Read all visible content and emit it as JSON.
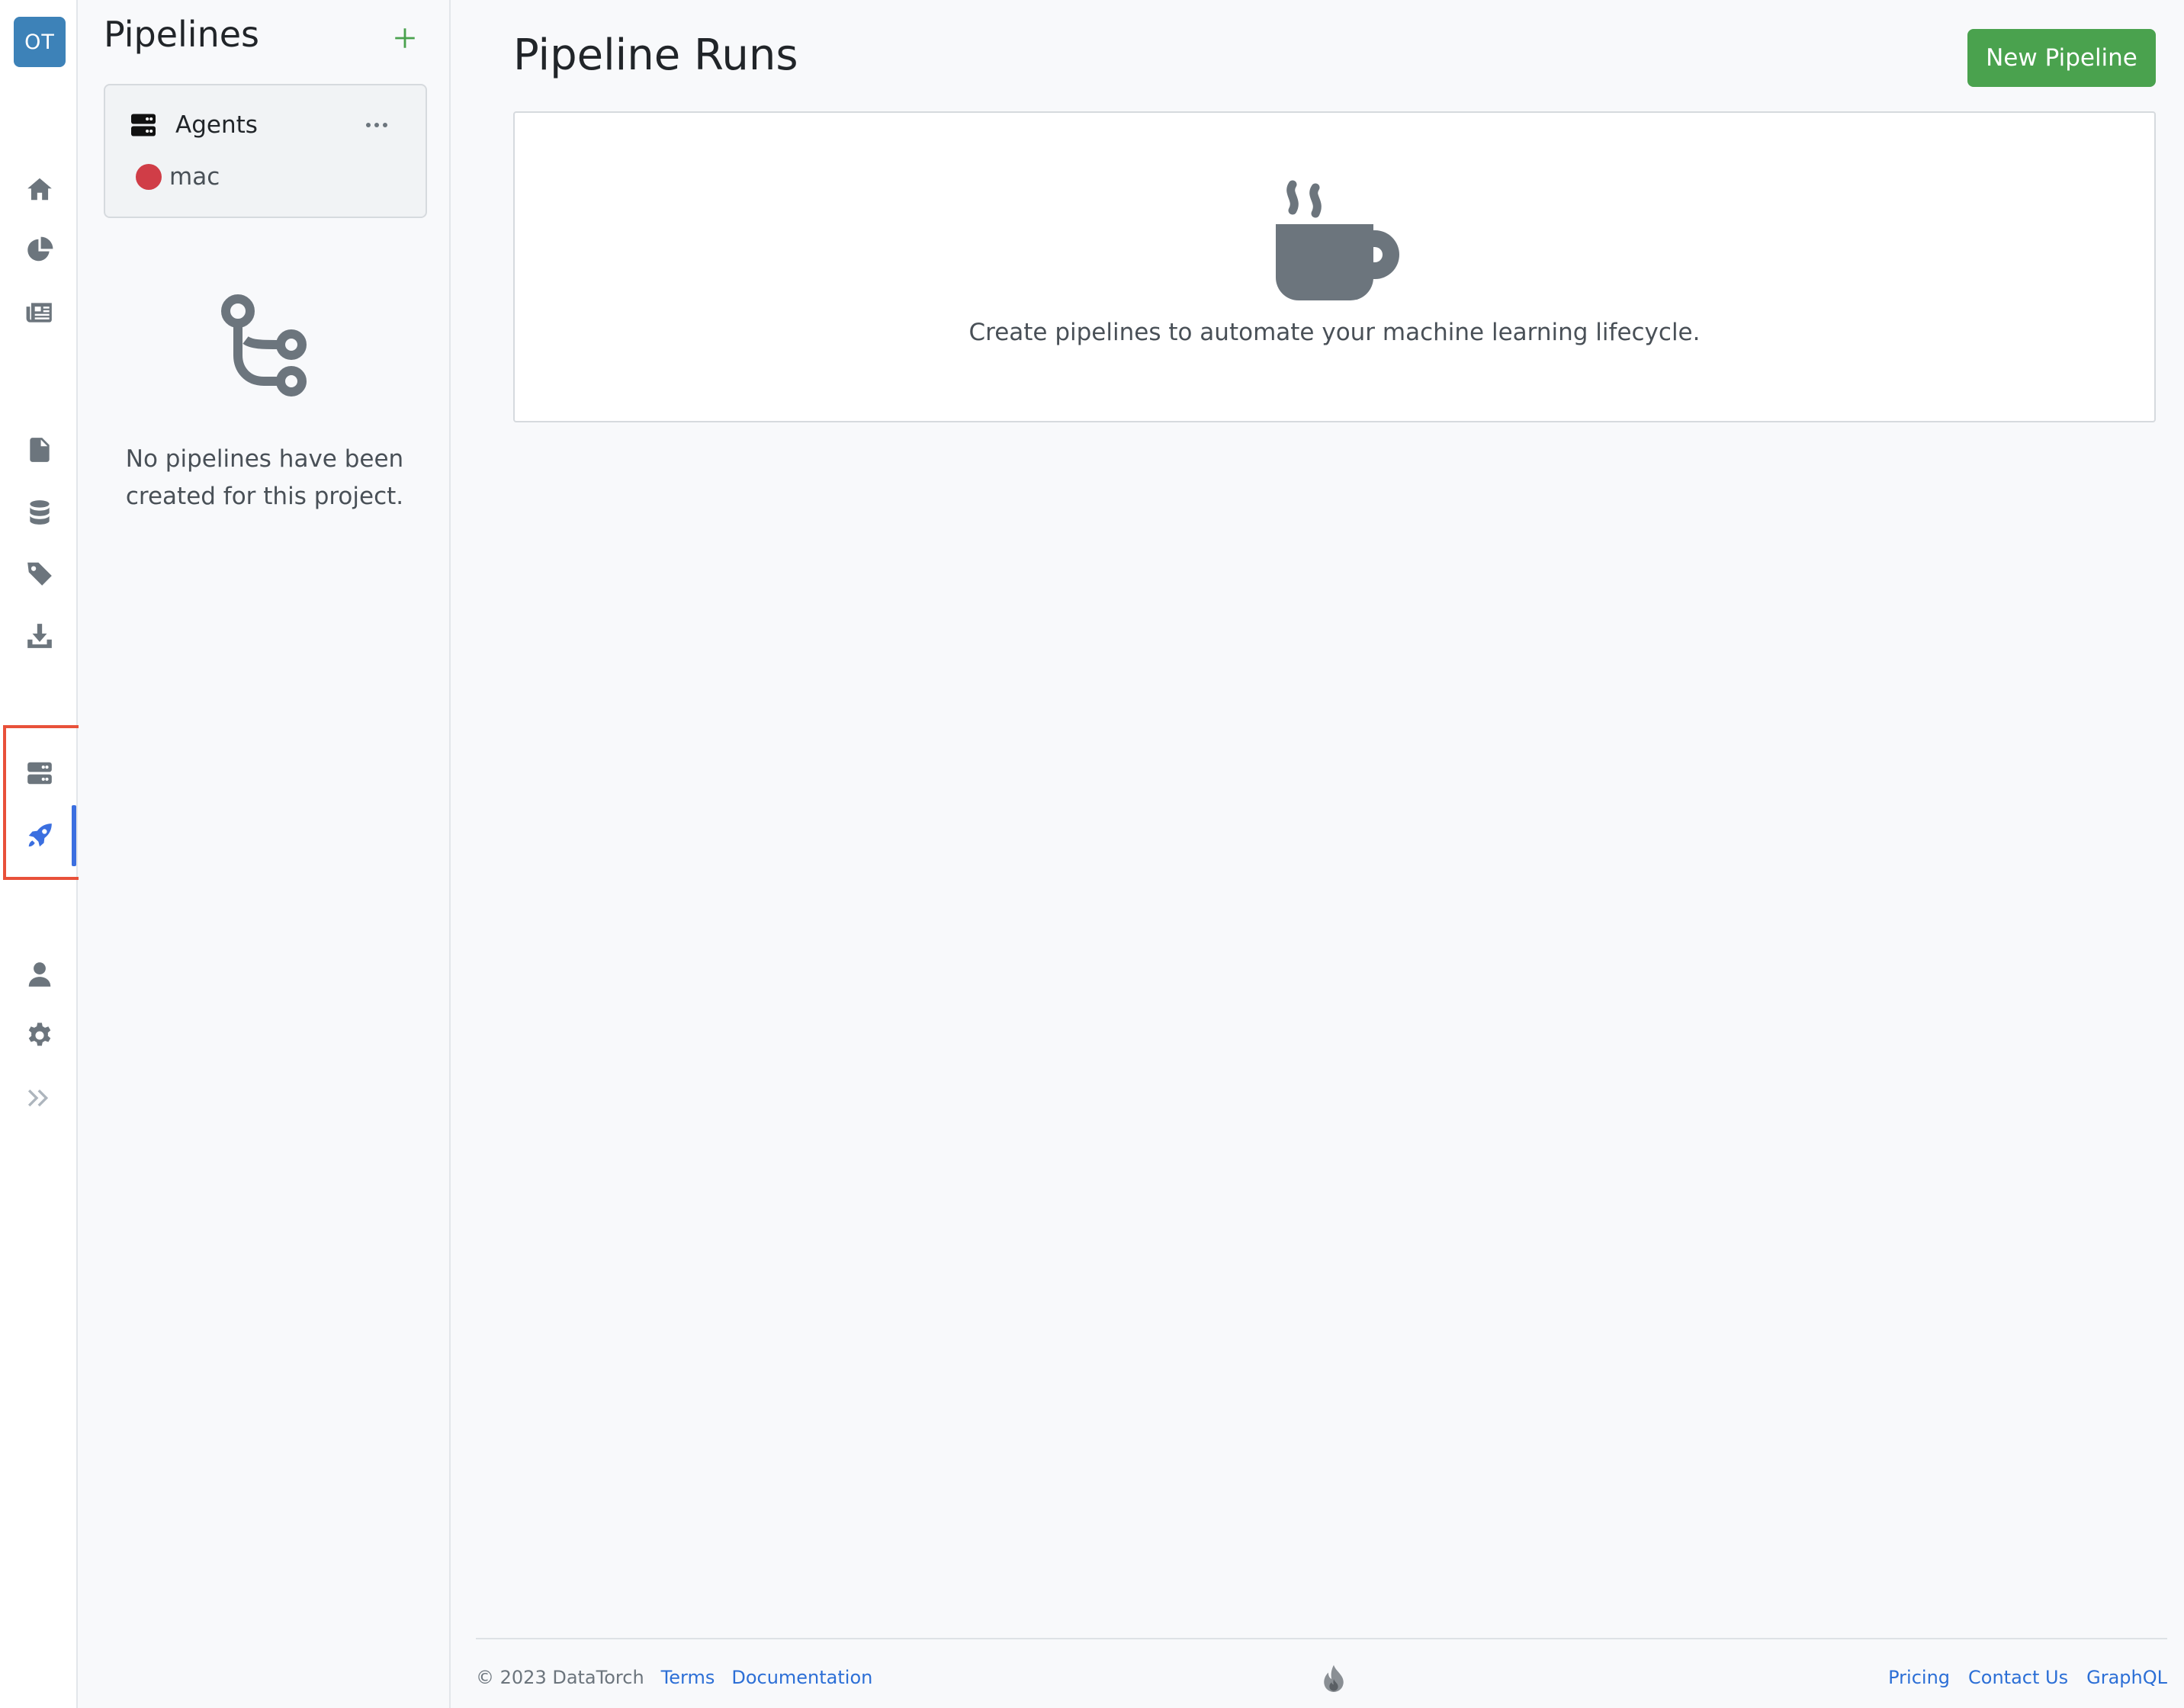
{
  "rail": {
    "avatar_initials": "OT",
    "items": [
      {
        "icon": "home-icon"
      },
      {
        "icon": "pie-chart-icon"
      },
      {
        "icon": "newspaper-icon"
      },
      {
        "icon": "file-icon"
      },
      {
        "icon": "database-icon"
      },
      {
        "icon": "tag-icon"
      },
      {
        "icon": "download-icon"
      },
      {
        "icon": "server-icon"
      },
      {
        "icon": "rocket-icon",
        "active": true
      },
      {
        "icon": "user-icon"
      },
      {
        "icon": "gear-icon"
      },
      {
        "icon": "chevrons-right-icon"
      }
    ],
    "active_color": "#3b6fe0"
  },
  "pipelines_panel": {
    "title": "Pipelines",
    "agents_card": {
      "label": "Agents",
      "agents": [
        {
          "name": "mac",
          "status_color": "#d03d47"
        }
      ]
    },
    "empty_message": "No pipelines have been created for this project."
  },
  "main": {
    "title": "Pipeline Runs",
    "new_button_label": "New Pipeline",
    "empty_state_message": "Create pipelines to automate your machine learning lifecycle."
  },
  "footer": {
    "copyright": "© 2023 DataTorch",
    "left_links": [
      "Terms",
      "Documentation"
    ],
    "right_links": [
      "Pricing",
      "Contact Us",
      "GraphQL"
    ]
  },
  "annotation": {
    "highlight_color": "#e8513a"
  },
  "colors": {
    "accent_green": "#4aa24e",
    "link_blue": "#2c6fd6",
    "avatar_blue": "#3d82b8"
  }
}
